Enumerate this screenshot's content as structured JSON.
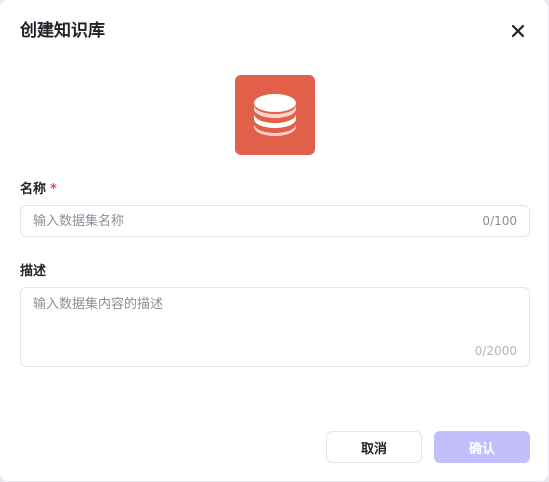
{
  "dialog": {
    "title": "创建知识库",
    "close_icon": "close-icon",
    "kb_icon": "database-icon",
    "kb_icon_color": "#e2604a"
  },
  "form": {
    "name": {
      "label": "名称",
      "required_mark": "*",
      "placeholder": "输入数据集名称",
      "counter": "0/100"
    },
    "description": {
      "label": "描述",
      "placeholder": "输入数据集内容的描述",
      "counter": "0/2000"
    }
  },
  "footer": {
    "cancel_label": "取消",
    "confirm_label": "确认",
    "confirm_color": "#c2bdfb"
  }
}
